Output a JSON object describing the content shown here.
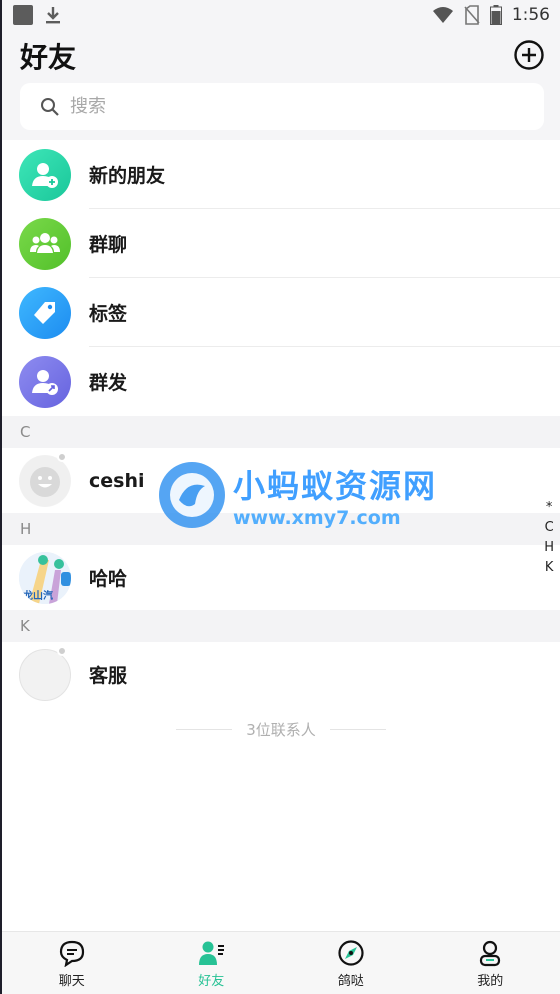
{
  "status_bar": {
    "time": "1:56"
  },
  "header": {
    "title": "好友"
  },
  "search": {
    "placeholder": "搜索"
  },
  "features": [
    {
      "label": "新的朋友",
      "icon": "add-user-icon"
    },
    {
      "label": "群聊",
      "icon": "group-icon"
    },
    {
      "label": "标签",
      "icon": "tag-icon"
    },
    {
      "label": "群发",
      "icon": "broadcast-user-icon"
    }
  ],
  "sections": [
    {
      "letter": "C",
      "contacts": [
        {
          "name": "ceshi"
        }
      ]
    },
    {
      "letter": "H",
      "contacts": [
        {
          "name": "哈哈",
          "avatar_text": "龙山汽"
        }
      ]
    },
    {
      "letter": "K",
      "contacts": [
        {
          "name": "客服"
        }
      ]
    }
  ],
  "contact_count": "3位联系人",
  "index_letters": [
    "*",
    "C",
    "H",
    "K"
  ],
  "watermark": {
    "title": "小蚂蚁资源网",
    "url": "www.xmy7.com"
  },
  "tabs": [
    {
      "label": "聊天",
      "icon": "chat-icon",
      "active": false
    },
    {
      "label": "好友",
      "icon": "friends-icon",
      "active": true
    },
    {
      "label": "鸽哒",
      "icon": "discover-icon",
      "active": false
    },
    {
      "label": "我的",
      "icon": "profile-icon",
      "active": false
    }
  ],
  "colors": {
    "accent": "#27c295",
    "watermark": "#1f8fff"
  }
}
